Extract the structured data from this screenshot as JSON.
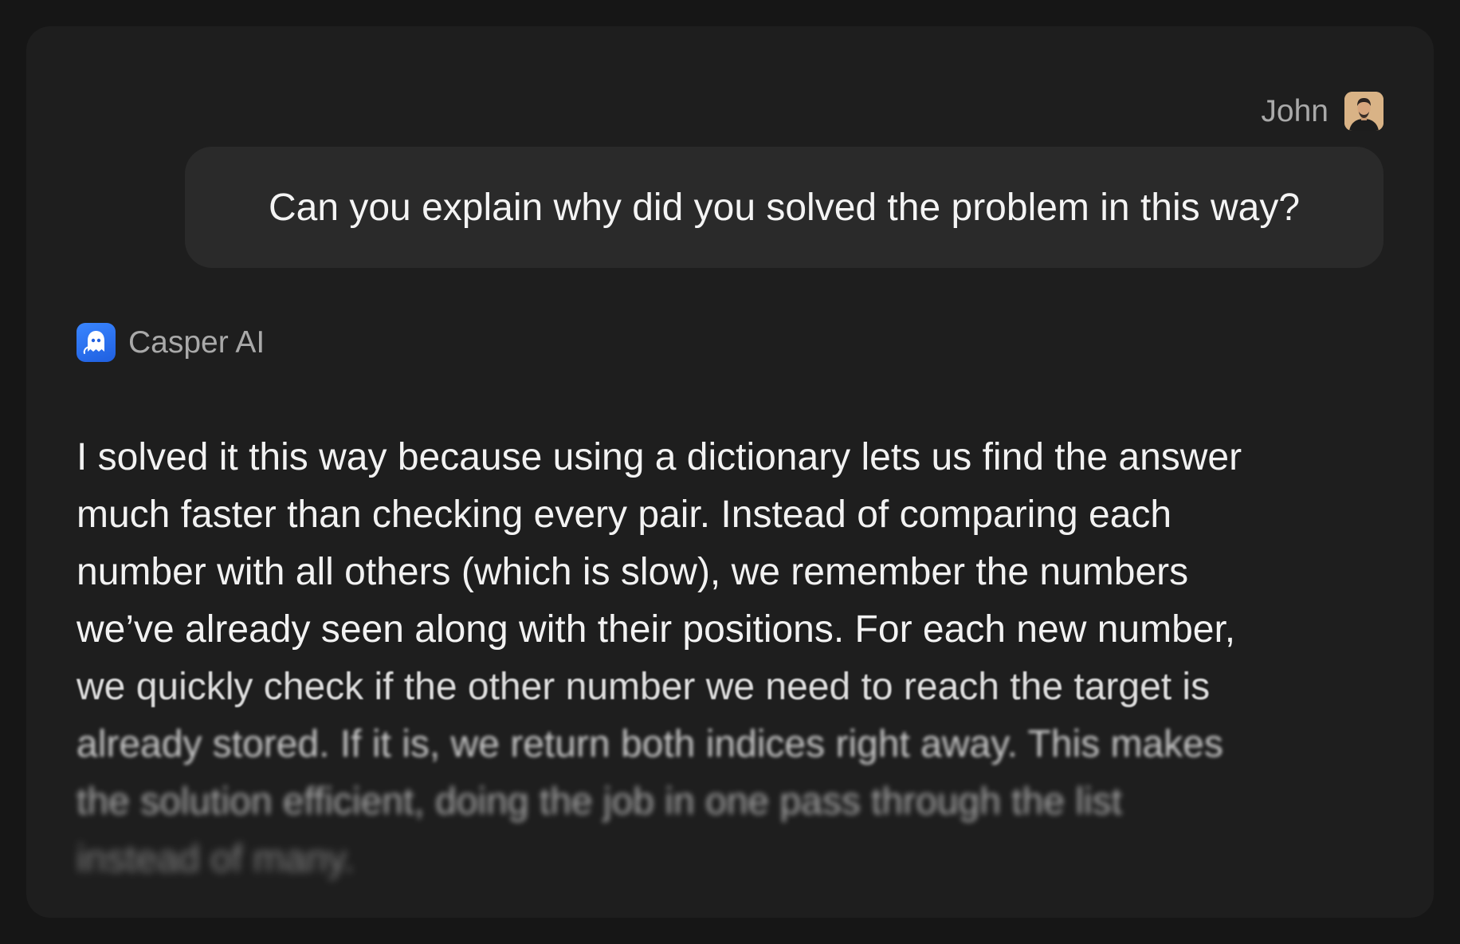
{
  "user": {
    "name": "John",
    "message": "Can you explain why did you solved the problem in this way?"
  },
  "assistant": {
    "name": "Casper AI",
    "message_lines": [
      "I solved it this way because using a dictionary lets us find the answer",
      "much faster than checking every pair. Instead of comparing each",
      "number with all others (which is slow), we remember the numbers",
      "we’ve already seen along with their positions. For each new number,",
      "we quickly check if the other number we need to reach the target is",
      "already stored. If it is, we return both indices right away. This makes",
      "the solution efficient, doing the job in one pass through the list",
      "instead of many."
    ]
  },
  "icons": {
    "avatar": "user-avatar-photo",
    "assistant_logo": "ghost-logo-icon"
  },
  "colors": {
    "background": "#161616",
    "card": "#1e1e1e",
    "user_bubble": "#2a2a2a",
    "text_primary": "#f2f2f2",
    "text_secondary": "#a9a9a9",
    "brand": "#2f78f5"
  }
}
